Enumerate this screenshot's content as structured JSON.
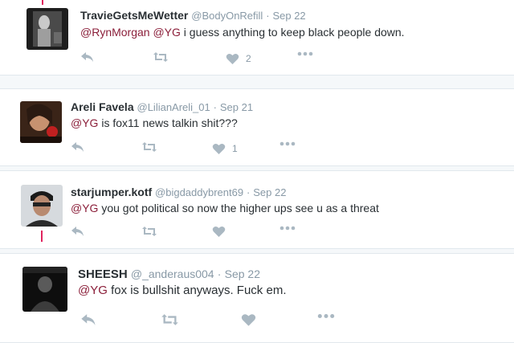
{
  "tweets": [
    {
      "name": "TravieGetsMeWetter",
      "handle": "@BodyOnRefill",
      "dot": "·",
      "time": "Sep 22",
      "mention1": "@RynMorgan",
      "mention2": "@YG",
      "body": " i guess anything to keep black people down.",
      "like_count": "2"
    },
    {
      "name": "Areli Favela",
      "handle": "@LilianAreli_01",
      "dot": "·",
      "time": "Sep 21",
      "mention1": "@YG",
      "body": " is fox11 news talkin shit???",
      "like_count": "1"
    },
    {
      "name": "starjumper.kotf",
      "handle": "@bigdaddybrent69",
      "dot": "·",
      "time": "Sep 22",
      "mention1": "@YG",
      "body": " you got political so now the higher ups see u as a threat",
      "like_count": ""
    },
    {
      "name": "SHEESH",
      "handle": "@_anderaus004",
      "dot": "·",
      "time": "Sep 22",
      "mention1": "@YG",
      "body": " fox is bullshit anyways. Fuck em.",
      "like_count": ""
    }
  ],
  "icons": {
    "reply": "reply-icon",
    "retweet": "retweet-icon",
    "like": "heart-icon",
    "more": "more-icon"
  },
  "colors": {
    "mention": "#8b1f3a",
    "icon": "#aab8c2",
    "thread_line": "#e0245e"
  }
}
